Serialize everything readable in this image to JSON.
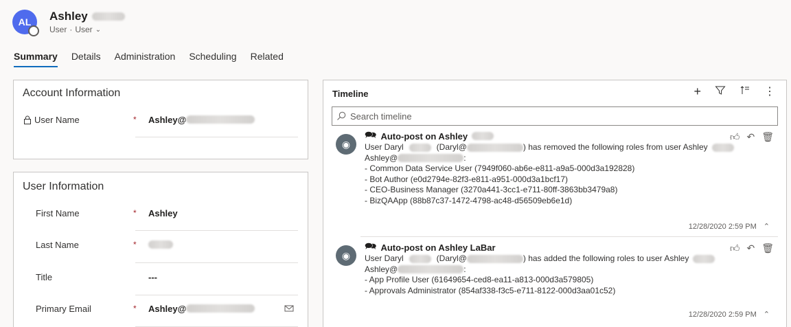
{
  "header": {
    "avatar_initials": "AL",
    "record_name": "Ashley",
    "record_type": "User",
    "form_name": "User"
  },
  "tabs": [
    {
      "label": "Summary"
    },
    {
      "label": "Details"
    },
    {
      "label": "Administration"
    },
    {
      "label": "Scheduling"
    },
    {
      "label": "Related"
    }
  ],
  "account_info": {
    "title": "Account Information",
    "user_name_label": "User Name",
    "user_name_value": "Ashley@"
  },
  "user_info": {
    "title": "User Information",
    "first_name_label": "First Name",
    "first_name_value": "Ashley",
    "last_name_label": "Last Name",
    "title_label": "Title",
    "title_value": "---",
    "email_label": "Primary Email",
    "email_value": "Ashley@",
    "required_mark": "*"
  },
  "timeline": {
    "title": "Timeline",
    "search_placeholder": "Search timeline",
    "posts": [
      {
        "title": "Auto-post on Ashley",
        "line1_a": "User Daryl",
        "line1_b": "(Daryl@",
        "line1_c": ") has removed the following roles from user Ashley",
        "line2_a": "Ashley@",
        "line2_b": ":",
        "items": [
          "- Common Data Service User (7949f060-ab6e-e811-a9a5-000d3a192828)",
          "- Bot Author (e0d2794e-82f3-e811-a951-000d3a1bcf17)",
          "- CEO-Business Manager (3270a441-3cc1-e711-80ff-3863bb3479a8)",
          "- BizQAApp (88b87c37-1472-4798-ac48-d56509eb6e1d)"
        ],
        "timestamp": "12/28/2020 2:59 PM"
      },
      {
        "title": "Auto-post on Ashley LaBar",
        "line1_a": "User Daryl",
        "line1_b": "(Daryl@",
        "line1_c": ") has added the following roles to user Ashley",
        "line2_a": "Ashley@",
        "line2_b": ":",
        "items": [
          "- App Profile User (61649654-ced8-ea11-a813-000d3a579805)",
          "- Approvals Administrator (854af338-f3c5-e711-8122-000d3aa01c52)"
        ],
        "timestamp": "12/28/2020 2:59 PM"
      }
    ]
  },
  "colors": {
    "avatar": "#4f6bed",
    "tab_underline": "#0f6cbd",
    "required": "#a4262c"
  },
  "icons": [
    "lock-icon",
    "plus-icon",
    "filter-icon",
    "sort-icon",
    "more-icon",
    "search-icon",
    "bot-icon",
    "post-icon",
    "like-icon",
    "reply-icon",
    "delete-icon",
    "chevron-up-icon",
    "email-icon"
  ]
}
